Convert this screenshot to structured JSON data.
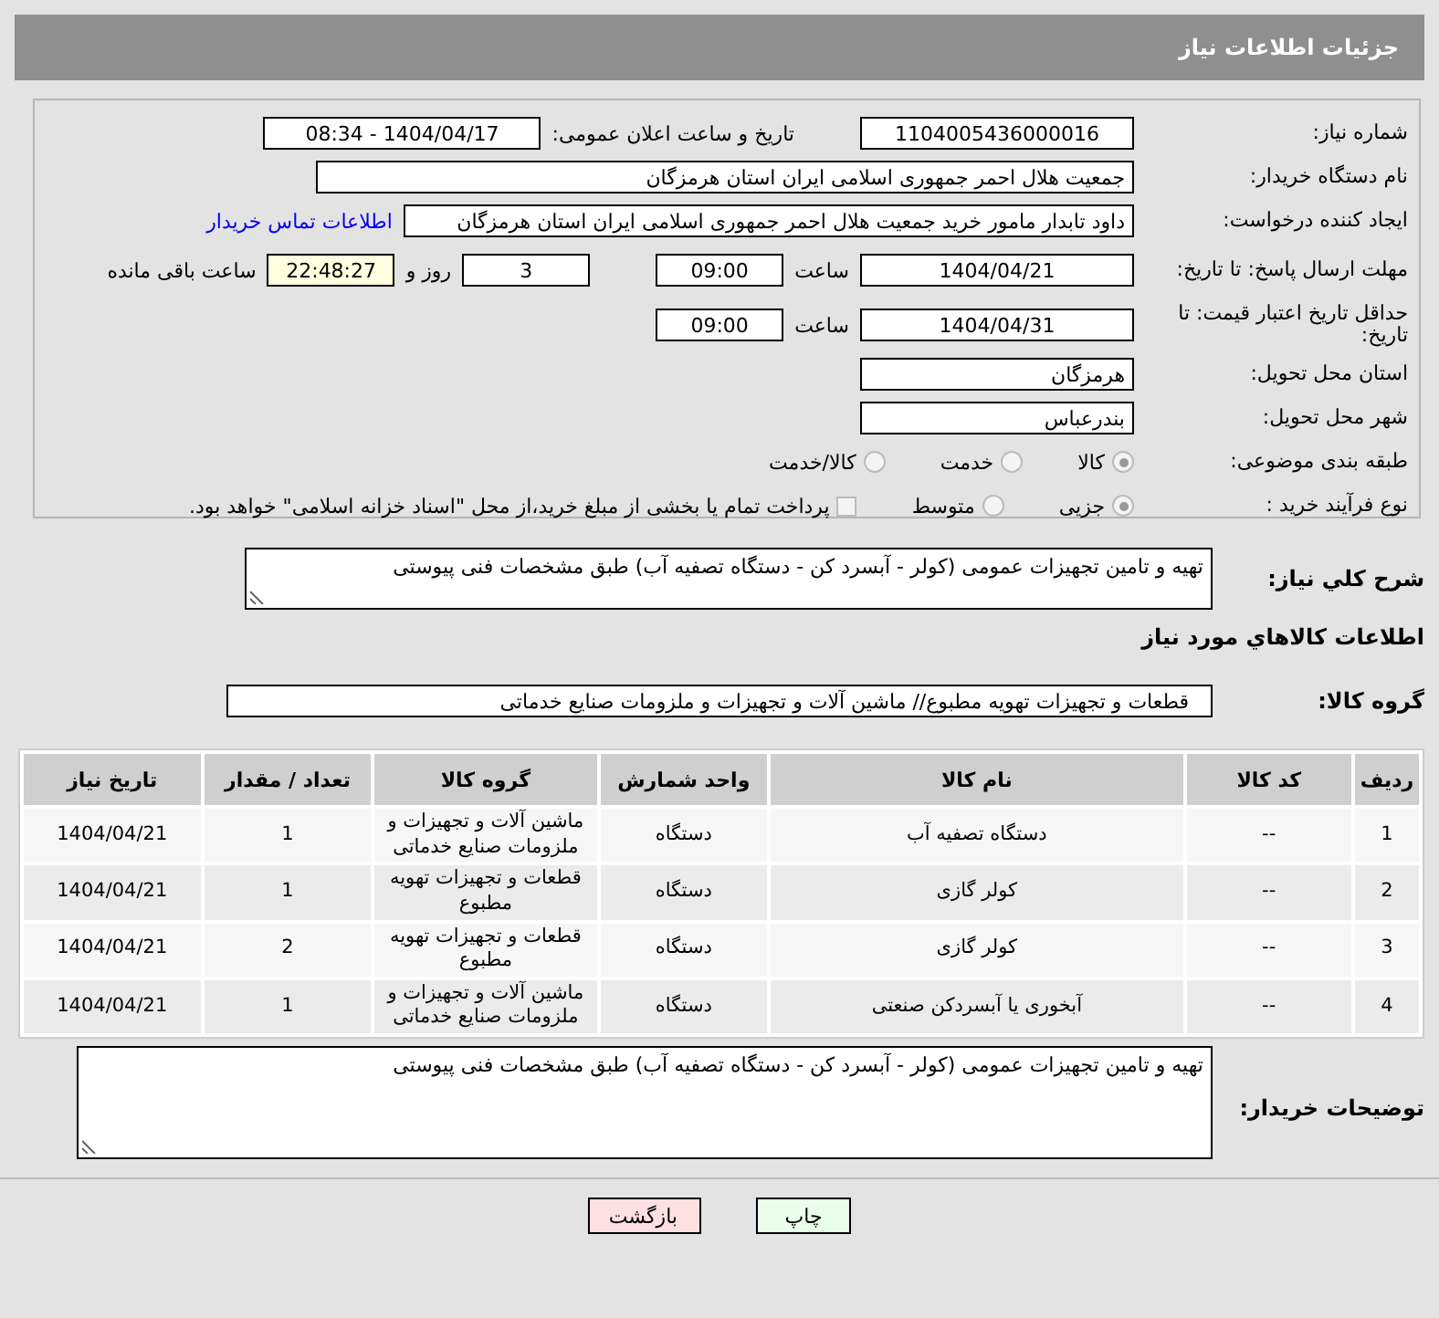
{
  "header": {
    "title": "جزئیات اطلاعات نیاز"
  },
  "need_number": {
    "label": "شماره نیاز:",
    "value": "1104005436000016"
  },
  "announce": {
    "label": "تاریخ و ساعت اعلان عمومی:",
    "value": "1404/04/17 - 08:34"
  },
  "buyer": {
    "label": "نام دستگاه خریدار:",
    "value": "جمعیت هلال احمر جمهوری اسلامی ایران استان هرمزگان"
  },
  "requester": {
    "label": "ایجاد کننده درخواست:",
    "value": "داود تابدار مامور خرید جمعیت هلال احمر جمهوری اسلامی ایران استان هرمزگان",
    "link": "اطلاعات تماس خریدار"
  },
  "reply_deadline": {
    "label": "مهلت ارسال پاسخ: تا تاریخ:",
    "date": "1404/04/21",
    "time_label": "ساعت",
    "time": "09:00",
    "days": "3",
    "days_label": "روز و",
    "remaining": "22:48:27",
    "remaining_label": "ساعت باقی مانده"
  },
  "price_validity": {
    "label": "حداقل تاریخ اعتبار قیمت: تا تاریخ:",
    "date": "1404/04/31",
    "time_label": "ساعت",
    "time": "09:00"
  },
  "province": {
    "label": "استان محل تحویل:",
    "value": "هرمزگان"
  },
  "city": {
    "label": "شهر محل تحویل:",
    "value": "بندرعباس"
  },
  "category": {
    "label": "طبقه بندی موضوعی:",
    "options": [
      {
        "label": "کالا",
        "selected": true
      },
      {
        "label": "خدمت",
        "selected": false
      },
      {
        "label": "کالا/خدمت",
        "selected": false
      }
    ]
  },
  "process": {
    "label": "نوع فرآیند خرید :",
    "options": [
      {
        "label": "جزیی",
        "selected": true
      },
      {
        "label": "متوسط",
        "selected": false
      }
    ],
    "payment": {
      "checked": false,
      "label": "پرداخت تمام یا بخشی از مبلغ خرید،از محل \"اسناد خزانه اسلامی\" خواهد بود."
    }
  },
  "description": {
    "label": "شرح کلي نیاز:",
    "value": "تهیه و تامین تجهیزات عمومی (کولر - آبسرد کن - دستگاه تصفیه آب) طبق مشخصات فنی پیوستی"
  },
  "goods_title": "اطلاعات کالاهاي مورد نیاز",
  "goods_group": {
    "label": "گروه کالا:",
    "value": "قطعات و تجهیزات تهویه مطبوع// ماشین آلات و تجهیزات و ملزومات صنایع خدماتی"
  },
  "table": {
    "columns": [
      "ردیف",
      "کد کالا",
      "نام کالا",
      "واحد شمارش",
      "گروه کالا",
      "تعداد / مقدار",
      "تاریخ نیاز"
    ],
    "rows": [
      [
        "1",
        "--",
        "دستگاه تصفیه آب",
        "دستگاه",
        "ماشین آلات و تجهیزات و ملزومات صنایع خدماتی",
        "1",
        "1404/04/21"
      ],
      [
        "2",
        "--",
        "کولر گازی",
        "دستگاه",
        "قطعات و تجهیزات تهویه مطبوع",
        "1",
        "1404/04/21"
      ],
      [
        "3",
        "--",
        "کولر گازی",
        "دستگاه",
        "قطعات و تجهیزات تهویه مطبوع",
        "2",
        "1404/04/21"
      ],
      [
        "4",
        "--",
        "آبخوری یا آبسردکن صنعتی",
        "دستگاه",
        "ماشین آلات و تجهیزات و ملزومات صنایع خدماتی",
        "1",
        "1404/04/21"
      ]
    ]
  },
  "buyer_notes": {
    "label": "توضیحات خریدار:",
    "value": "تهیه و تامین تجهیزات عمومی (کولر - آبسرد کن - دستگاه تصفیه آب) طبق مشخصات فنی پیوستی"
  },
  "buttons": [
    {
      "label": "چاپ",
      "kind": "print"
    },
    {
      "label": "بازگشت",
      "kind": "back"
    }
  ]
}
